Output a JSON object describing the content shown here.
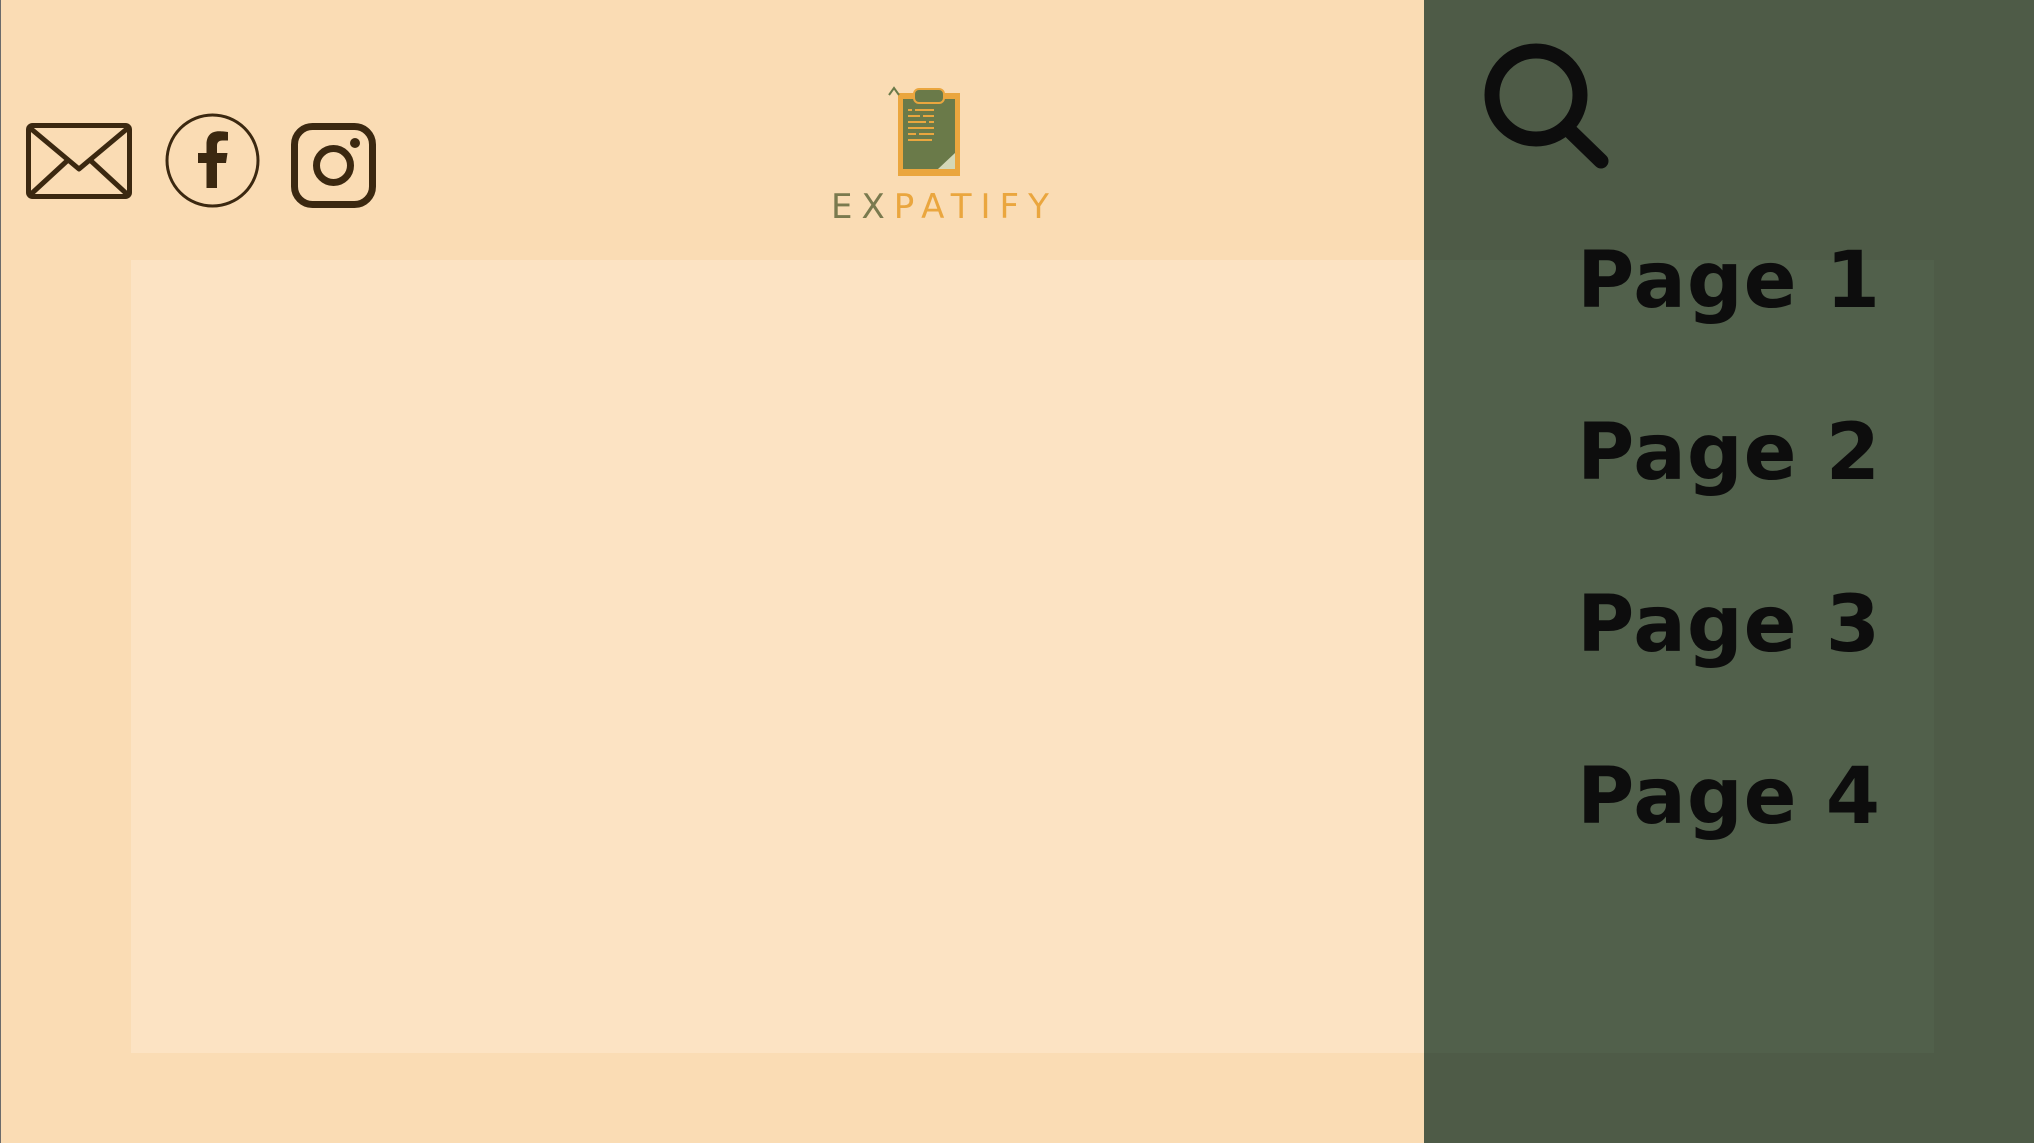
{
  "brand": {
    "name_part1": "EX",
    "name_part2": "PATIFY"
  },
  "nav": {
    "items": [
      {
        "label": "Page 1"
      },
      {
        "label": "Page 2"
      },
      {
        "label": "Page 3"
      },
      {
        "label": "Page 4"
      }
    ]
  },
  "icons": {
    "search": "search-icon",
    "email": "mail-icon",
    "facebook": "facebook-icon",
    "instagram": "instagram-icon"
  },
  "colors": {
    "background": "#fadcb4",
    "content_panel": "#fce3c3",
    "sidebar": "#4e5b47",
    "icon_brown": "#3b2810",
    "brand_green": "#7a7a4e",
    "brand_orange": "#eaa63e"
  }
}
